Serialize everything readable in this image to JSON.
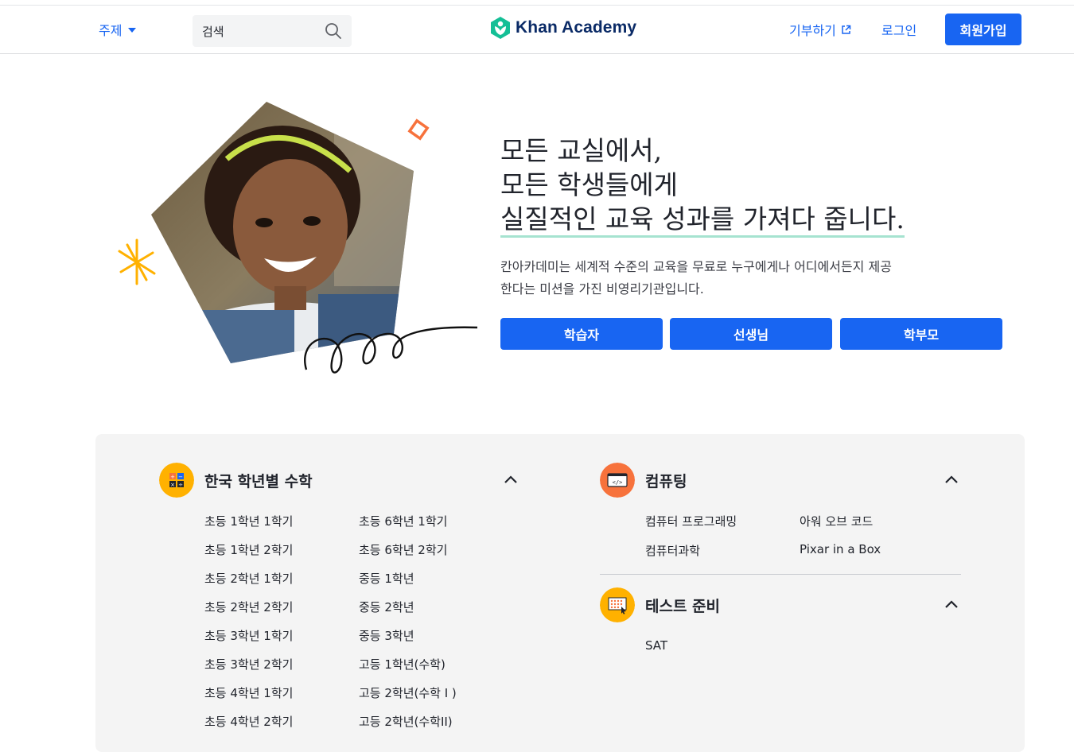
{
  "header": {
    "subjects_label": "주제",
    "search_placeholder": "검색",
    "logo_text": "Khan Academy",
    "donate_label": "기부하기",
    "login_label": "로그인",
    "signup_label": "회원가입"
  },
  "hero": {
    "headline_line1": "모든 교실에서,",
    "headline_line2": "모든 학생들에게",
    "headline_line3": "실질적인 교육 성과를 가져다 줍니다.",
    "mission_line1": "칸아카데미는 세계적 수준의 교육을 무료로 누구에게나 어디에서든지 제공",
    "mission_line2": "한다는 미션을 가진 비영리기관입니다.",
    "buttons": [
      "학습자",
      "선생님",
      "학부모"
    ]
  },
  "categories": {
    "math": {
      "title": "한국 학년별 수학",
      "col1": [
        "초등 1학년 1학기",
        "초등 1학년 2학기",
        "초등 2학년 1학기",
        "초등 2학년 2학기",
        "초등 3학년 1학기",
        "초등 3학년 2학기",
        "초등 4학년 1학기",
        "초등 4학년 2학기"
      ],
      "col2": [
        "초등 6학년 1학기",
        "초등 6학년 2학기",
        "중등 1학년",
        "중등 2학년",
        "중등 3학년",
        "고등 1학년(수학)",
        "고등 2학년(수학 I )",
        "고등 2학년(수학II)"
      ]
    },
    "computing": {
      "title": "컴퓨팅",
      "col1": [
        "컴퓨터 프로그래밍",
        "컴퓨터과학"
      ],
      "col2": [
        "아워 오브 코드",
        "Pixar in a Box"
      ]
    },
    "test_prep": {
      "title": "테스트 준비",
      "items": [
        "SAT"
      ]
    }
  },
  "colors": {
    "brand_blue": "#1865f2",
    "logo_green": "#14bf96",
    "logo_navy": "#0a2a66",
    "math_icon": "#ffb100",
    "computing_icon": "#f7723c",
    "test_icon": "#ffb100"
  }
}
